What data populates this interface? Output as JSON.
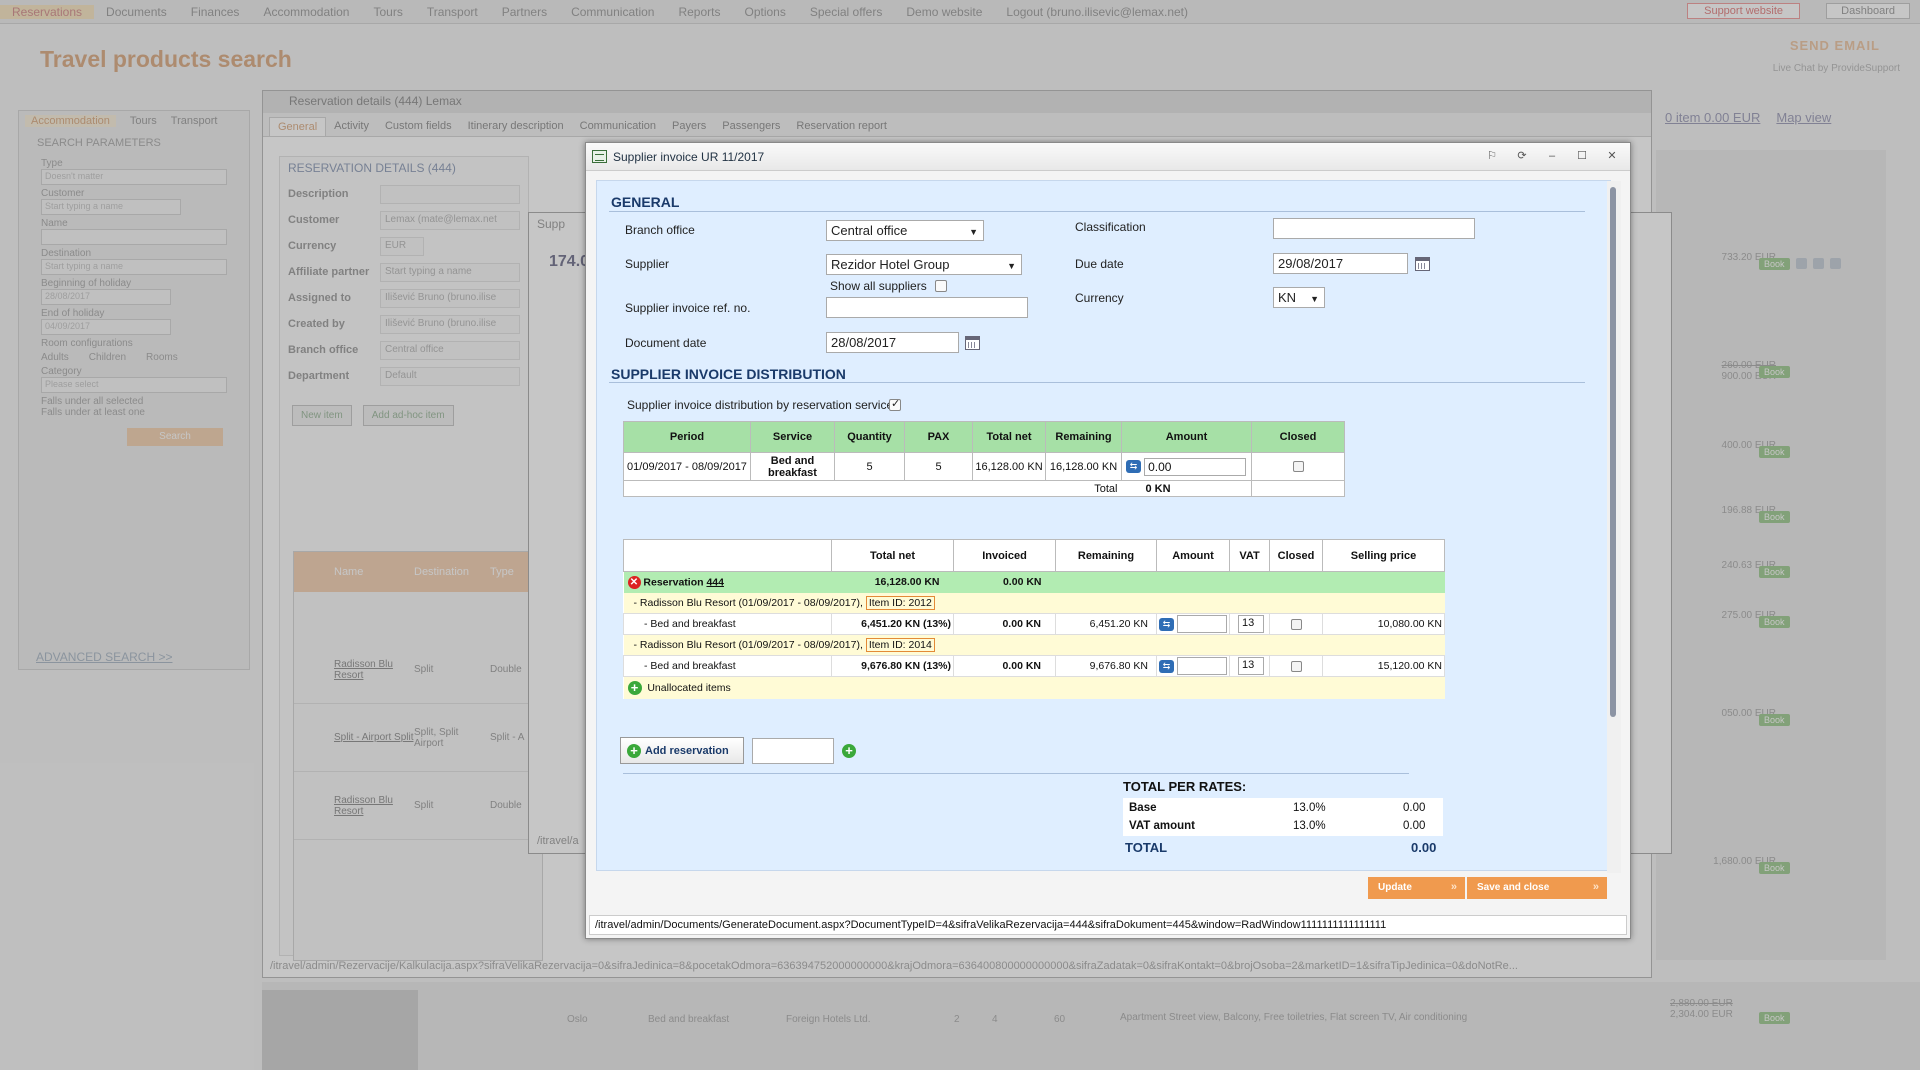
{
  "topnav": {
    "items": [
      "Reservations",
      "Documents",
      "Finances",
      "Accommodation",
      "Tours",
      "Transport",
      "Partners",
      "Communication",
      "Reports",
      "Options",
      "Special offers",
      "Demo website",
      "Logout (bruno.ilisevic@lemax.net)"
    ],
    "support": "Support website",
    "dashboard": "Dashboard"
  },
  "page": {
    "title": "Travel products search",
    "send_email": "SEND EMAIL",
    "livechat": "Live Chat by ProvideSupport"
  },
  "search_panel": {
    "tabs": [
      "Accommodation",
      "Tours",
      "Transport"
    ],
    "heading": "SEARCH PARAMETERS",
    "fields": [
      {
        "label": "Type",
        "value": "Doesn't matter"
      },
      {
        "label": "Customer",
        "value": "Start typing a name"
      },
      {
        "label": "Name",
        "value": ""
      },
      {
        "label": "Destination",
        "value": "Start typing a name"
      },
      {
        "label": "Beginning of holiday",
        "value": "28/08/2017"
      },
      {
        "label": "End of holiday",
        "value": "04/09/2017"
      }
    ],
    "room_config": "Room configurations",
    "adults": "Adults",
    "children": "Children",
    "rooms": "Rooms",
    "category": "Category",
    "category_value": "Please select",
    "falls_all": "Falls under all selected",
    "falls_one": "Falls under at least one",
    "search": "Search",
    "advanced": "ADVANCED SEARCH >>"
  },
  "cart": {
    "label": "0 item 0.00 EUR",
    "map": "Map view"
  },
  "results_prices": [
    {
      "price": "733.20 EUR",
      "old": ""
    },
    {
      "price": "900.00 EUR",
      "old": "260.00 EUR"
    },
    {
      "price": "400.00 EUR",
      "old": ""
    },
    {
      "price": "196.88 EUR",
      "old": ""
    },
    {
      "price": "240.63 EUR",
      "old": ""
    },
    {
      "price": "275.00 EUR",
      "old": ""
    },
    {
      "price": "050.00 EUR",
      "old": ""
    },
    {
      "price": "1,680.00 EUR",
      "old": ""
    },
    {
      "price": "2,304.00 EUR",
      "old": "2,880.00 EUR"
    }
  ],
  "book_label": "Book",
  "reservation_details": {
    "title": "Reservation details (444) Lemax",
    "tabs": [
      "General",
      "Activity",
      "Custom fields",
      "Itinerary description",
      "Communication",
      "Payers",
      "Passengers",
      "Reservation report"
    ],
    "heading": "RESERVATION DETAILS (444)",
    "rows": [
      {
        "label": "Description",
        "value": ""
      },
      {
        "label": "Customer",
        "value": "Lemax (mate@lemax.net"
      },
      {
        "label": "Currency",
        "value": "EUR"
      },
      {
        "label": "Affiliate partner",
        "value": "Start typing a name"
      },
      {
        "label": "Assigned to",
        "value": "Ilišević Bruno (bruno.ilise"
      },
      {
        "label": "Created by",
        "value": "Ilišević Bruno (bruno.ilise"
      },
      {
        "label": "Branch office",
        "value": "Central office"
      },
      {
        "label": "Department",
        "value": "Default"
      }
    ],
    "new_item": "New item",
    "add_adhoc": "Add ad-hoc item",
    "grid_headers": [
      "Name",
      "Destination",
      "Type"
    ],
    "grid_rows": [
      {
        "name": "Radisson Blu Resort",
        "dest": "Split",
        "type": "Double"
      },
      {
        "name": "Split - Airport Split",
        "dest": "Split, Split Airport",
        "type": "Split - A"
      },
      {
        "name": "Radisson Blu Resort",
        "dest": "Split",
        "type": "Double"
      }
    ],
    "status_url": "/itravel/admin/Rezervacije/Kalkulacija.aspx?sifraVelikaRezervacija=0&sifraJedinica=8&pocetakOdmora=636394752000000000&krajOdmora=636400800000000000&sifraZadatak=0&sifraKontakt=0&brojOsoba=2&marketID=1&sifraTipJedinica=0&doNotRe..."
  },
  "back_dialog": {
    "title": "Supp",
    "amount": "174.0",
    "url": "/itravel/a"
  },
  "bottom_result": {
    "dest": "Oslo",
    "service": "Bed and breakfast",
    "partner": "Foreign Hotels Ltd.",
    "n1": "2",
    "n2": "4",
    "n3": "60",
    "desc": "Apartment Street view, Balcony, Free toiletries, Flat screen TV, Air conditioning"
  },
  "dialog": {
    "title": "Supplier invoice UR 11/2017",
    "general": {
      "heading": "GENERAL",
      "branch_office_label": "Branch office",
      "branch_office_value": "Central office",
      "supplier_label": "Supplier",
      "supplier_value": "Rezidor Hotel Group",
      "show_all_label": "Show all suppliers",
      "ref_label": "Supplier invoice ref. no.",
      "ref_value": "",
      "doc_date_label": "Document date",
      "doc_date_value": "28/08/2017",
      "classification_label": "Classification",
      "classification_value": "",
      "due_date_label": "Due date",
      "due_date_value": "29/08/2017",
      "currency_label": "Currency",
      "currency_value": "KN"
    },
    "distribution": {
      "heading": "SUPPLIER INVOICE DISTRIBUTION",
      "by_services_label": "Supplier invoice distribution by reservation services",
      "headers": [
        "Period",
        "Service",
        "Quantity",
        "PAX",
        "Total net",
        "Remaining",
        "Amount",
        "Closed"
      ],
      "row": {
        "period": "01/09/2017 - 08/09/2017",
        "service": "Bed and breakfast",
        "quantity": "5",
        "pax": "5",
        "total_net": "16,128.00 KN",
        "remaining": "16,128.00 KN",
        "amount": "0.00"
      },
      "total_label": "Total",
      "total_value": "0 KN"
    },
    "invoice_table": {
      "headers": [
        "Total net",
        "Invoiced",
        "Remaining",
        "Amount",
        "VAT",
        "Closed",
        "Selling price"
      ],
      "reservation": {
        "label": "Reservation",
        "number": "444",
        "total_net": "16,128.00 KN",
        "invoiced": "0.00 KN"
      },
      "groups": [
        {
          "hotel": "- Radisson Blu Resort (01/09/2017 - 08/09/2017)",
          "item_id": "Item ID: 2012",
          "service": "- Bed and breakfast",
          "total_net": "6,451.20 KN (13%)",
          "invoiced": "0.00 KN",
          "remaining": "6,451.20 KN",
          "vat": "13",
          "selling": "10,080.00 KN"
        },
        {
          "hotel": "- Radisson Blu Resort (01/09/2017 - 08/09/2017)",
          "item_id": "Item ID: 2014",
          "service": "- Bed and breakfast",
          "total_net": "9,676.80 KN (13%)",
          "invoiced": "0.00 KN",
          "remaining": "9,676.80 KN",
          "vat": "13",
          "selling": "15,120.00 KN"
        }
      ],
      "unallocated": "Unallocated items"
    },
    "add_reservation": "Add reservation",
    "totals": {
      "title": "TOTAL PER RATES:",
      "rows": [
        {
          "label": "Base",
          "rate": "13.0%",
          "value": "0.00"
        },
        {
          "label": "VAT amount",
          "rate": "13.0%",
          "value": "0.00"
        }
      ],
      "total_label": "TOTAL",
      "total_value": "0.00"
    },
    "update": "Update",
    "save_close": "Save and close",
    "status_url": "/itravel/admin/Documents/GenerateDocument.aspx?DocumentTypeID=4&sifraVelikaRezervacija=444&sifraDokument=445&window=RadWindow1111111111111111"
  },
  "colors": {
    "accent": "#f09a4e",
    "green_header": "#a6e0a6",
    "dialog_body": "#dfeeff",
    "title_blue": "#1a3a6a"
  }
}
